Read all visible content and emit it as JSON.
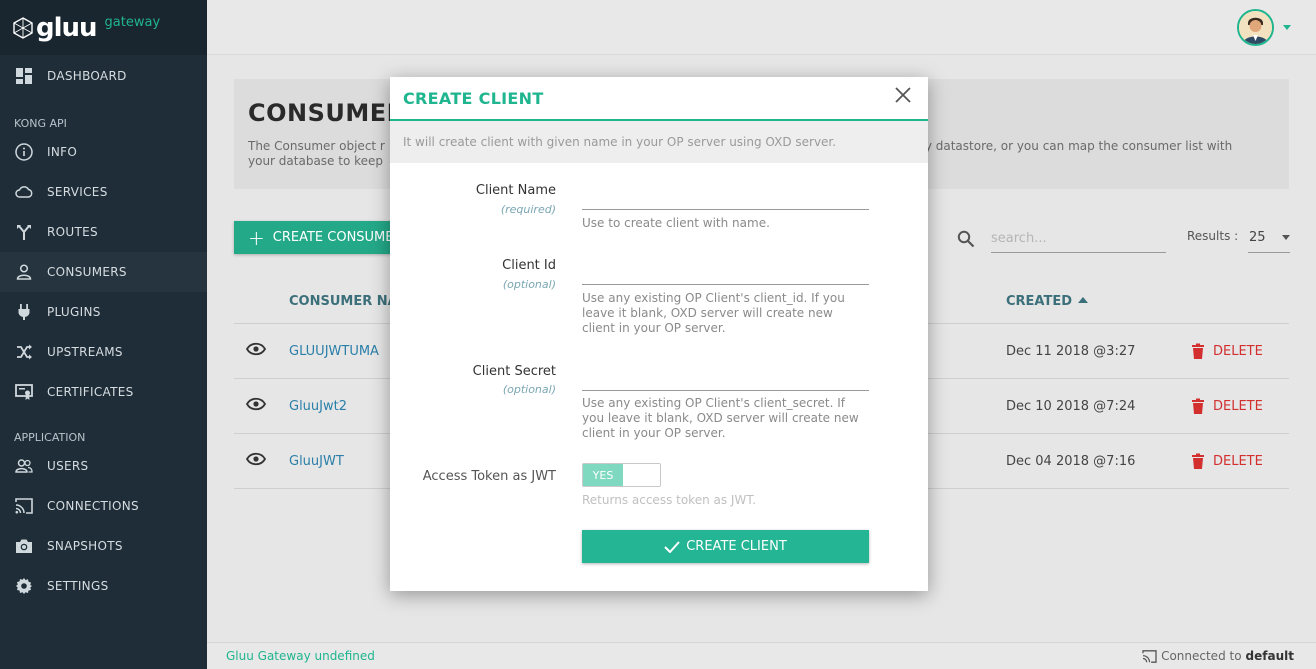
{
  "brand": {
    "logo": "gluu",
    "sub": "gateway"
  },
  "sidebar": {
    "items_top": [
      {
        "label": "DASHBOARD",
        "icon": "dashboard-icon"
      }
    ],
    "section_kong": "KONG API",
    "items_kong": [
      {
        "label": "INFO",
        "icon": "info-icon"
      },
      {
        "label": "SERVICES",
        "icon": "cloud-icon"
      },
      {
        "label": "ROUTES",
        "icon": "routes-icon"
      },
      {
        "label": "CONSUMERS",
        "icon": "person-icon",
        "active": true
      },
      {
        "label": "PLUGINS",
        "icon": "plug-icon"
      },
      {
        "label": "UPSTREAMS",
        "icon": "shuffle-icon"
      },
      {
        "label": "CERTIFICATES",
        "icon": "certificate-icon"
      }
    ],
    "section_app": "APPLICATION",
    "items_app": [
      {
        "label": "USERS",
        "icon": "users-icon"
      },
      {
        "label": "CONNECTIONS",
        "icon": "cast-icon"
      },
      {
        "label": "SNAPSHOTS",
        "icon": "camera-icon"
      },
      {
        "label": "SETTINGS",
        "icon": "gear-icon"
      }
    ]
  },
  "page": {
    "title": "CONSUMER",
    "description_left": "The Consumer object r",
    "description_left2": "your database to keep",
    "description_right": "ary datastore, or you can map the consumer list with",
    "create_button": "CREATE CONSUME",
    "search_placeholder": "search...",
    "results_label": "Results :",
    "results_value": "25"
  },
  "table": {
    "col_name": "CONSUMER NA",
    "col_created": "CREATED",
    "rows": [
      {
        "name": "GLUUJWTUMA",
        "created": "Dec 11 2018 @3:27",
        "delete": "DELETE"
      },
      {
        "name": "GluuJwt2",
        "created": "Dec 10 2018 @7:24",
        "delete": "DELETE"
      },
      {
        "name": "GluuJWT",
        "created": "Dec 04 2018 @7:16",
        "delete": "DELETE"
      }
    ]
  },
  "footer": {
    "left": "Gluu Gateway undefined",
    "right_prefix": "Connected to",
    "right_value": "default"
  },
  "modal": {
    "title": "CREATE CLIENT",
    "info": "It will create client with given name in your OP server using OXD server.",
    "client_name_label": "Client Name",
    "client_name_sub": "(required)",
    "client_name_hint": "Use to create client with name.",
    "client_id_label": "Client Id",
    "client_id_sub": "(optional)",
    "client_id_hint": "Use any existing OP Client's client_id. If you leave it blank, OXD server will create new client in your OP server.",
    "client_secret_label": "Client Secret",
    "client_secret_sub": "(optional)",
    "client_secret_hint": "Use any existing OP Client's client_secret. If you leave it blank, OXD server will create new client in your OP server.",
    "access_token_label": "Access Token as JWT",
    "toggle_value": "YES",
    "access_token_hint": "Returns access token as JWT.",
    "submit": "CREATE CLIENT"
  },
  "colors": {
    "accent": "#1fb58f",
    "sidebar": "#1f2d38",
    "delete": "#d32f2f"
  }
}
